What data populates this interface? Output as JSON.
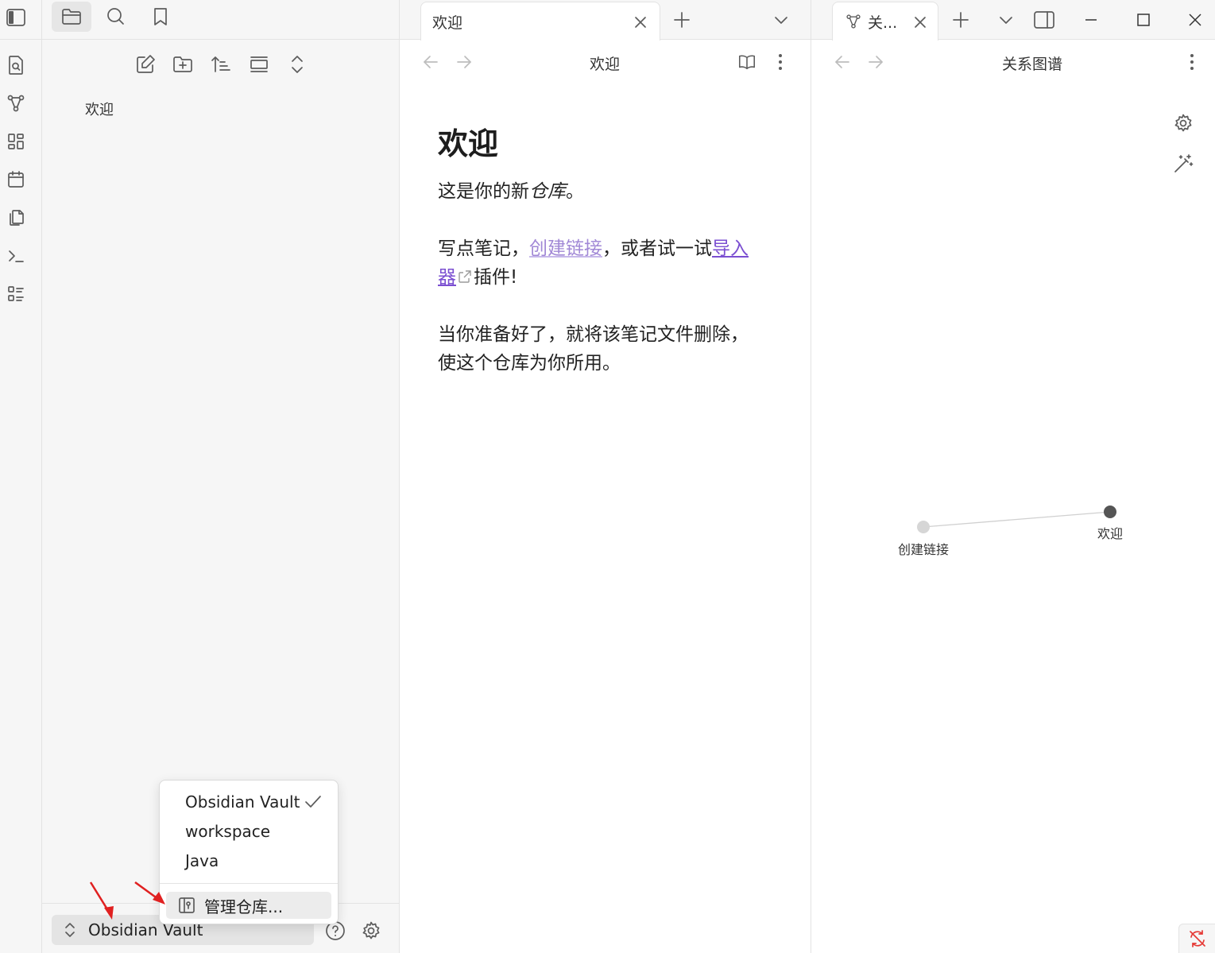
{
  "left_sidebar": {
    "files": [
      "欢迎"
    ],
    "vault_name": "Obsidian Vault"
  },
  "vault_menu": {
    "items": [
      {
        "label": "Obsidian Vault",
        "checked": true
      },
      {
        "label": "workspace",
        "checked": false
      },
      {
        "label": "Java",
        "checked": false
      }
    ],
    "manage_label": "管理仓库..."
  },
  "main_pane": {
    "tab_title": "欢迎",
    "view_title": "欢迎",
    "note": {
      "heading": "欢迎",
      "p1_prefix": "这是你的新",
      "p1_italic": "仓库",
      "p1_suffix": "。",
      "p2_prefix": "写点笔记，",
      "p2_link1": "创建链接",
      "p2_middle": "，或者试一试",
      "p2_link2": "导入器",
      "p2_suffix": "插件!",
      "p3": "当你准备好了，就将该笔记文件删除，使这个仓库为你所用。"
    }
  },
  "right_pane": {
    "tab_title": "关...",
    "view_title": "关系图谱",
    "graph": {
      "nodes": [
        {
          "label": "创建链接",
          "resolved": false
        },
        {
          "label": "欢迎",
          "resolved": true
        }
      ]
    }
  },
  "colors": {
    "internal_link": "#a188d6",
    "external_link": "#7b4fd1",
    "sync_error": "#e53935",
    "annotation_arrow": "#e02020"
  }
}
